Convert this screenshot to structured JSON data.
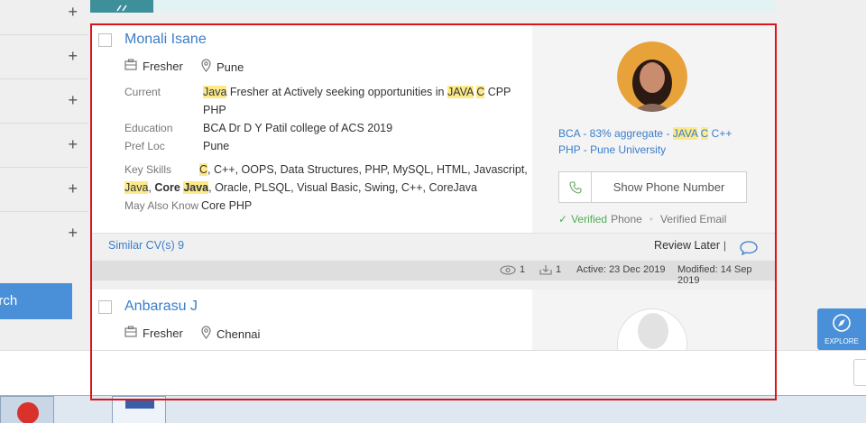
{
  "sidebar": {
    "rows": [
      "+",
      "+",
      "+",
      "+",
      "+",
      "+"
    ],
    "search_label": "arch"
  },
  "candidates": [
    {
      "name": "Monali Isane",
      "experience": "Fresher",
      "location": "Pune",
      "labels": {
        "current": "Current",
        "education": "Education",
        "pref_loc": "Pref Loc",
        "key_skills": "Key Skills",
        "may_also_know": "May Also Know"
      },
      "current": {
        "hl1": "Java",
        "t1": " Fresher at Actively seeking opportunities in ",
        "hl2": "JAVA",
        "t2": " ",
        "hl3": "C",
        "t3": " CPP",
        "line2": "PHP"
      },
      "education": "BCA Dr D Y Patil college of ACS 2019",
      "pref_loc": "Pune",
      "key_skills": {
        "hl1": "C",
        "t1": ", C++, OOPS, Data Structures, PHP, MySQL, HTML, Javascript,",
        "hl2": "Java",
        "t2": ", ",
        "b1": "Core ",
        "hl3": "Java",
        "t3": ", Oracle, PLSQL, Visual Basic, Swing, C++, CoreJava"
      },
      "may_also_know": "Core PHP",
      "summary": {
        "t1": "BCA - 83% aggregate - ",
        "hl1": "JAVA",
        "t2": " ",
        "hl2": "C",
        "t3": " C++",
        "line2": "PHP - Pune University"
      },
      "phone_button": "Show Phone Number",
      "verified_phone_a": "Verified",
      "verified_phone_b": "Phone",
      "verified_email": "Verified Email",
      "footer": {
        "similar": "Similar CV(s) 9",
        "review_later": "Review Later",
        "separator": "|"
      },
      "stats": {
        "views": "1",
        "downloads": "1",
        "active": "Active: 23 Dec 2019",
        "modified": "Modified: 14 Sep 2019"
      }
    },
    {
      "name": "Anbarasu J",
      "experience": "Fresher",
      "location": "Chennai"
    }
  ],
  "explore": {
    "label": "EXPLORE"
  },
  "colors": {
    "accent": "#3a7ec9",
    "highlight": "#fce98a",
    "frame": "#d9151b",
    "button": "#4a90d9"
  }
}
